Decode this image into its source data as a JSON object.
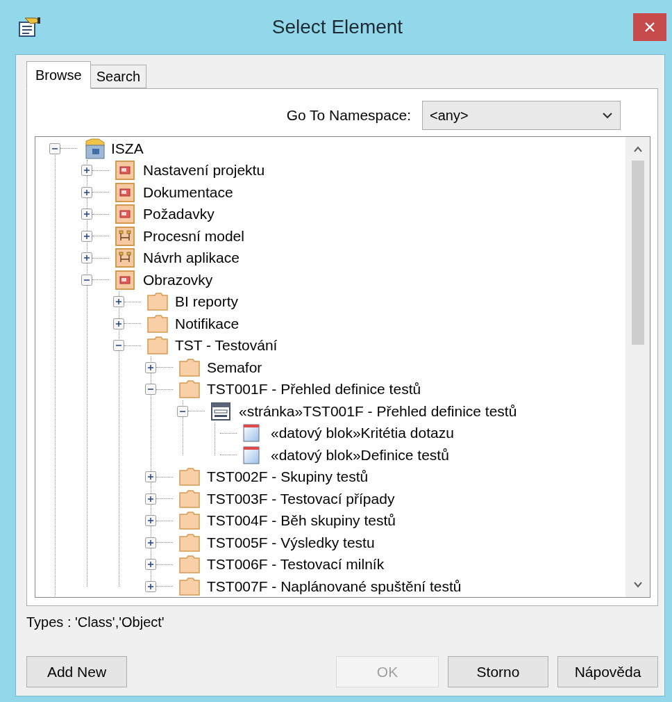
{
  "window": {
    "title": "Select Element"
  },
  "tabs": [
    {
      "label": "Browse",
      "selected": true
    },
    {
      "label": "Search",
      "selected": false
    }
  ],
  "namespace": {
    "label": "Go To Namespace:",
    "value": "<any>"
  },
  "tree": [
    {
      "label": "ISZA",
      "kind": "model",
      "expanded": true,
      "children": [
        {
          "label": "Nastavení projektu",
          "kind": "package",
          "expanded": false
        },
        {
          "label": "Dokumentace",
          "kind": "package",
          "expanded": false
        },
        {
          "label": "Požadavky",
          "kind": "package",
          "expanded": false
        },
        {
          "label": "Procesní model",
          "kind": "diagram-package",
          "expanded": false
        },
        {
          "label": "Návrh aplikace",
          "kind": "diagram-package",
          "expanded": false
        },
        {
          "label": "Obrazovky",
          "kind": "package",
          "expanded": true,
          "children": [
            {
              "label": "BI reporty",
              "kind": "folder",
              "expanded": false
            },
            {
              "label": "Notifikace",
              "kind": "folder",
              "expanded": false
            },
            {
              "label": "TST - Testování",
              "kind": "folder",
              "expanded": true,
              "children": [
                {
                  "label": "Semafor",
                  "kind": "folder",
                  "expanded": false
                },
                {
                  "label": "TST001F - Přehled definice testů",
                  "kind": "folder",
                  "expanded": true,
                  "children": [
                    {
                      "label": "«stránka»TST001F - Přehled definice testů",
                      "kind": "page",
                      "expanded": true,
                      "children": [
                        {
                          "label": "«datový blok»Kritétia dotazu",
                          "kind": "datablock"
                        },
                        {
                          "label": "«datový blok»Definice testů",
                          "kind": "datablock"
                        }
                      ]
                    }
                  ]
                },
                {
                  "label": "TST002F - Skupiny testů",
                  "kind": "folder",
                  "expanded": false
                },
                {
                  "label": "TST003F - Testovací případy",
                  "kind": "folder",
                  "expanded": false
                },
                {
                  "label": "TST004F - Běh skupiny testů",
                  "kind": "folder",
                  "expanded": false
                },
                {
                  "label": "TST005F - Výsledky testu",
                  "kind": "folder",
                  "expanded": false
                },
                {
                  "label": "TST006F - Testovací milník",
                  "kind": "folder",
                  "expanded": false
                },
                {
                  "label": "TST007F - Naplánované spuštění testů",
                  "kind": "folder",
                  "expanded": false
                }
              ]
            }
          ]
        }
      ]
    }
  ],
  "types_text": "Types : 'Class','Object'",
  "buttons": [
    {
      "label": "Add New",
      "disabled": false
    },
    {
      "label": "OK",
      "disabled": true
    },
    {
      "label": "Storno",
      "disabled": false
    },
    {
      "label": "Nápověda",
      "disabled": false
    }
  ]
}
